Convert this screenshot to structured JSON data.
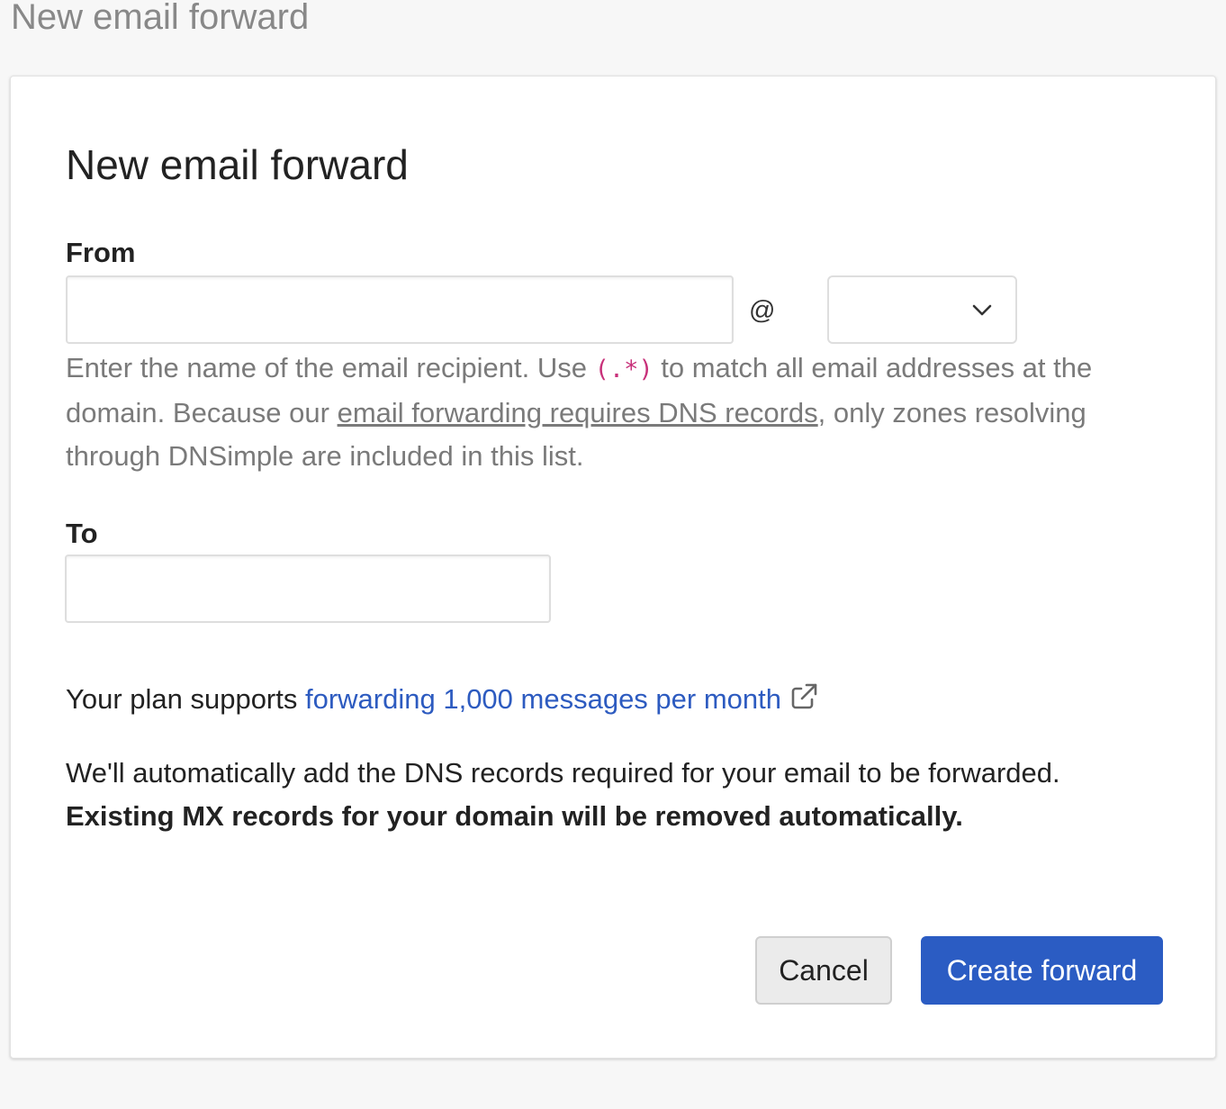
{
  "page": {
    "heading": "New email forward"
  },
  "form": {
    "title": "New email forward",
    "from": {
      "label": "From",
      "value": "",
      "placeholder": "",
      "at_symbol": "@",
      "domain_selected": ""
    },
    "help": {
      "part1": "Enter the name of the email recipient. Use ",
      "code": "(.*)",
      "part2": " to match all email addresses at the domain. Because our ",
      "link": "email forwarding requires DNS records",
      "part3": ", only zones resolving through DNSimple are included in this list."
    },
    "to": {
      "label": "To",
      "value": "",
      "placeholder": ""
    },
    "plan": {
      "prefix": "Your plan supports ",
      "link": "forwarding 1,000 messages per month",
      "link_icon": "external-link-icon"
    },
    "dns_notice": {
      "text": "We'll automatically add the DNS records required for your email to be forwarded.",
      "warning": "Existing MX records for your domain will be removed automatically."
    },
    "buttons": {
      "cancel": "Cancel",
      "create": "Create forward"
    }
  },
  "colors": {
    "primary": "#2b5cc3",
    "link": "#2d5bc0",
    "code": "#c8317a",
    "muted_text": "#7a7a7a"
  }
}
